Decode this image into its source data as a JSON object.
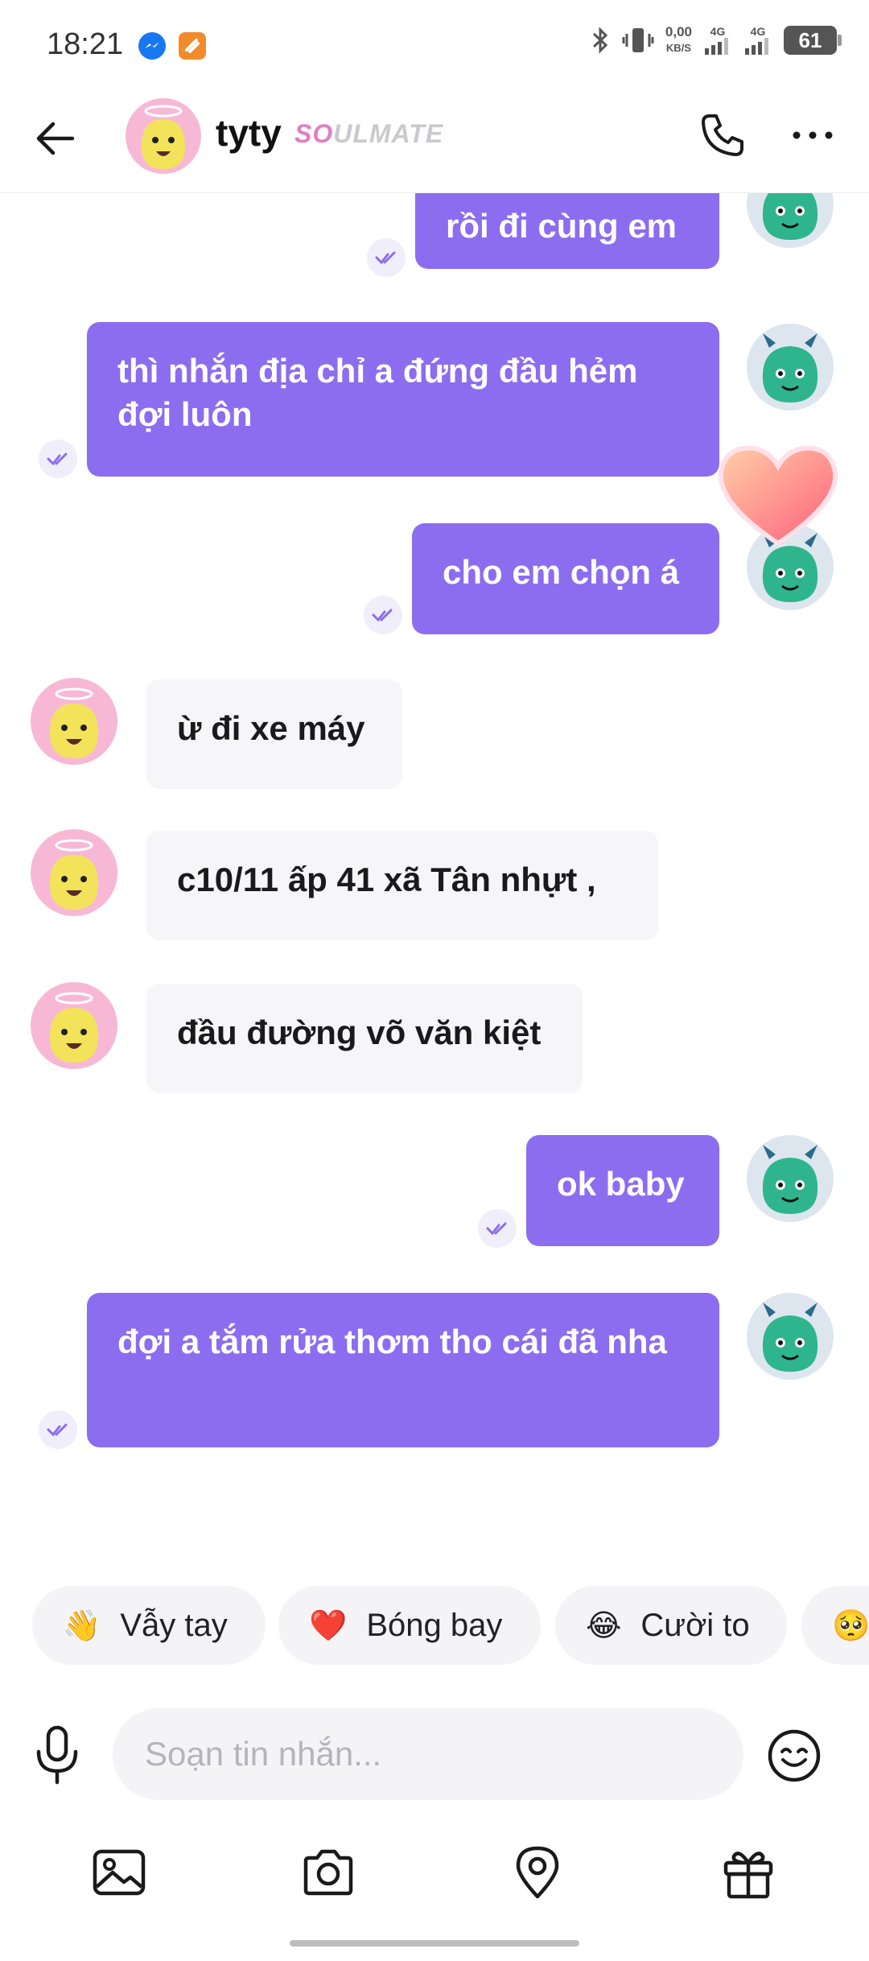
{
  "status_bar": {
    "time": "18:21",
    "speed_value": "0,00",
    "speed_unit": "KB/S",
    "net1": "4G",
    "net2": "4G",
    "battery": "61"
  },
  "header": {
    "name": "tyty",
    "badge_part1": "SO",
    "badge_part2": "ULMATE"
  },
  "messages": [
    {
      "side": "out",
      "text": "rồi đi cùng em"
    },
    {
      "side": "out",
      "text": "thì nhắn địa chỉ a đứng đầu hẻm đợi luôn"
    },
    {
      "side": "out",
      "text": "cho em chọn á"
    },
    {
      "side": "in",
      "text": "ừ đi xe máy"
    },
    {
      "side": "in",
      "text": "c10/11 ấp 41 xã Tân nhựt ,"
    },
    {
      "side": "in",
      "text": "đầu đường võ văn kiệt"
    },
    {
      "side": "out",
      "text": "ok baby"
    },
    {
      "side": "out",
      "text": "đợi a tắm rửa thơm tho cái đã nha"
    }
  ],
  "quick_replies": [
    {
      "emoji": "👋",
      "label": "Vẫy tay"
    },
    {
      "emoji": "❤️",
      "label": "Bóng bay"
    },
    {
      "emoji": "😂",
      "label": "Cười to"
    },
    {
      "emoji": "🥺",
      "label": ""
    }
  ],
  "composer": {
    "placeholder": "Soạn tin nhắn..."
  },
  "colors": {
    "outgoing_bubble": "#8c6cef",
    "incoming_bubble": "#f6f6f9",
    "badge_pink": "#e07fc4"
  }
}
